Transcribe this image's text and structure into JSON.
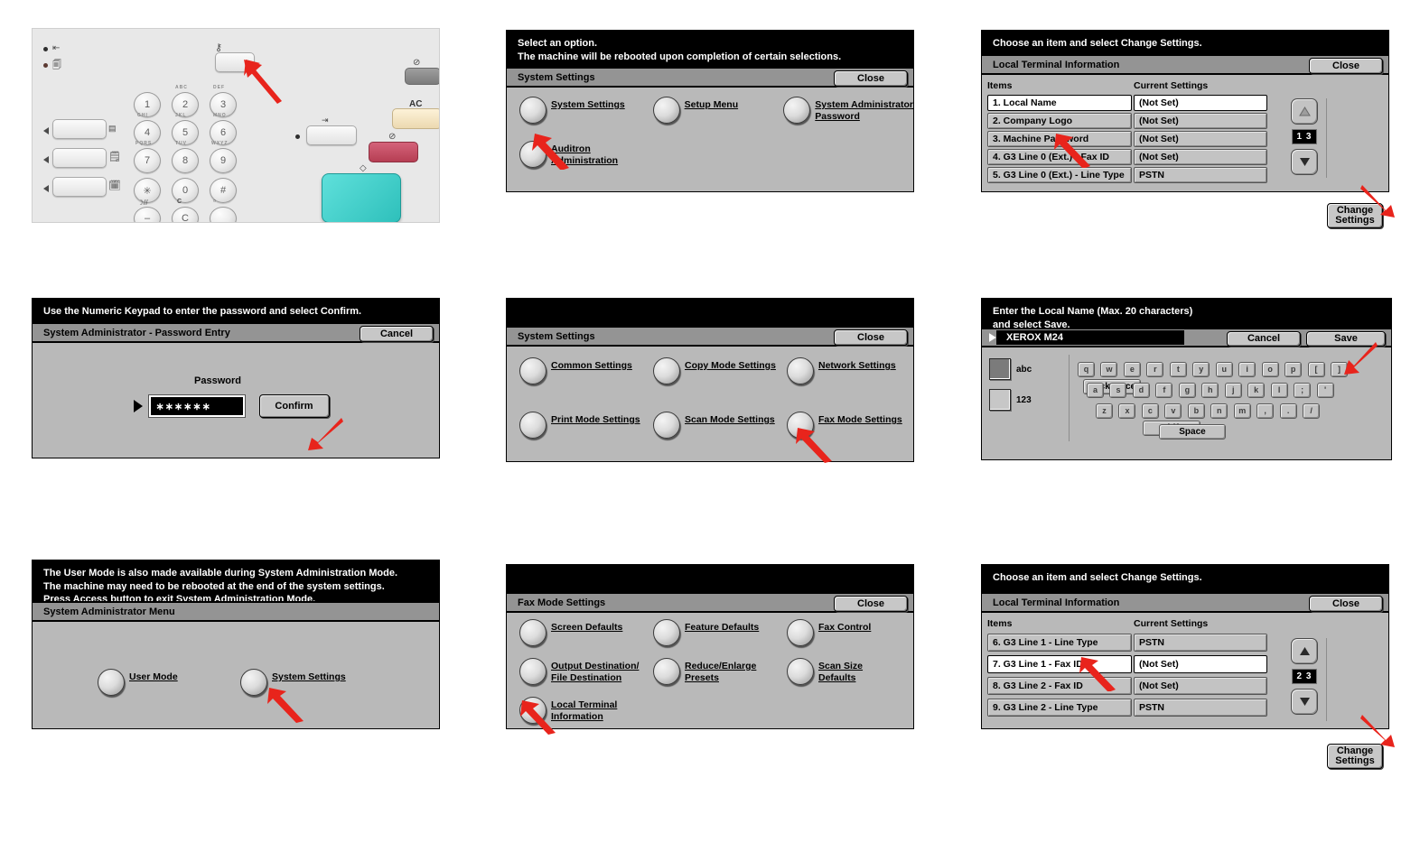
{
  "figure": {
    "panel1": {
      "name": "control-panel-photo",
      "keys": [
        "1",
        "2",
        "3",
        "4",
        "5",
        "6",
        "7",
        "8",
        "9",
        "*",
        "0",
        "#",
        "-",
        "C",
        ""
      ],
      "key_letters": [
        "ABC",
        "DEF",
        "GHI",
        "JKL",
        "MNO",
        "PQRS",
        "TUV",
        "WXYZ"
      ],
      "ac_label": "AC",
      "c_label": "C"
    },
    "panel2": {
      "message": [
        "Select an option.",
        "The machine will be rebooted upon completion of certain selections."
      ],
      "title": "System Settings",
      "close": "Close",
      "options": [
        {
          "label": [
            "System Settings"
          ]
        },
        {
          "label": [
            "Setup Menu"
          ]
        },
        {
          "label": [
            "System Administrator",
            "Password"
          ]
        },
        {
          "label": [
            "Auditron",
            "Administration"
          ]
        }
      ]
    },
    "panel3": {
      "message": [
        "Choose an item and select Change Settings."
      ],
      "title": "Local Terminal Information",
      "close": "Close",
      "col_items": "Items",
      "col_settings": "Current Settings",
      "page": "1 3",
      "change_settings": [
        "Change",
        "Settings"
      ],
      "rows": [
        {
          "item": "1. Local Name",
          "value": "(Not Set)",
          "selected": true
        },
        {
          "item": "2. Company Logo",
          "value": "(Not Set)",
          "selected": false
        },
        {
          "item": "3. Machine Password",
          "value": "(Not Set)",
          "selected": false
        },
        {
          "item": "4. G3 Line 0 (Ext.) - Fax ID",
          "value": "(Not Set)",
          "selected": false
        },
        {
          "item": "5. G3 Line 0 (Ext.) - Line Type",
          "value": "PSTN",
          "selected": false
        }
      ]
    },
    "panel4": {
      "message": [
        "Use the Numeric Keypad to enter the password and select Confirm."
      ],
      "title": "System Administrator - Password Entry",
      "cancel": "Cancel",
      "password_label": "Password",
      "password_value": "∗∗∗∗∗∗",
      "confirm": "Confirm"
    },
    "panel5": {
      "message": [
        ""
      ],
      "title": "System Settings",
      "close": "Close",
      "options": [
        {
          "label": [
            "Common Settings"
          ]
        },
        {
          "label": [
            "Copy Mode Settings"
          ]
        },
        {
          "label": [
            "Network Settings"
          ]
        },
        {
          "label": [
            "Print Mode Settings"
          ]
        },
        {
          "label": [
            "Scan Mode Settings"
          ]
        },
        {
          "label": [
            "Fax Mode Settings"
          ]
        }
      ]
    },
    "panel6": {
      "message": [
        "Enter the Local Name (Max. 20 characters)",
        "and select Save."
      ],
      "input_value": "XEROX M24",
      "cancel": "Cancel",
      "save": "Save",
      "mode_abc": "abc",
      "mode_123": "123",
      "row1": [
        "q",
        "w",
        "e",
        "r",
        "t",
        "y",
        "u",
        "i",
        "o",
        "p",
        "[",
        "]"
      ],
      "row2": [
        "a",
        "s",
        "d",
        "f",
        "g",
        "h",
        "j",
        "k",
        "l",
        ";",
        "'"
      ],
      "row3": [
        "z",
        "x",
        "c",
        "v",
        "b",
        "n",
        "m",
        ",",
        ".",
        "/"
      ],
      "backspace": "Backspace",
      "shift": "Shift",
      "space": "Space"
    },
    "panel7": {
      "message": [
        "The User Mode is also made available during System Administration Mode.",
        "The machine may need to be rebooted at the end of the system settings.",
        "Press Access button to exit System Administration Mode."
      ],
      "title": "System Administrator Menu",
      "options": [
        {
          "label": [
            "User Mode"
          ]
        },
        {
          "label": [
            "System Settings"
          ]
        }
      ]
    },
    "panel8": {
      "message": [
        ""
      ],
      "title": "Fax Mode Settings",
      "close": "Close",
      "options": [
        {
          "label": [
            "Screen Defaults"
          ]
        },
        {
          "label": [
            "Feature Defaults"
          ]
        },
        {
          "label": [
            "Fax Control"
          ]
        },
        {
          "label": [
            "Output Destination/",
            "File Destination"
          ]
        },
        {
          "label": [
            "Reduce/Enlarge",
            "Presets"
          ]
        },
        {
          "label": [
            "Scan Size",
            "Defaults"
          ]
        },
        {
          "label": [
            "Local Terminal",
            "Information"
          ]
        }
      ]
    },
    "panel9": {
      "message": [
        "Choose an item and select Change Settings."
      ],
      "title": "Local Terminal Information",
      "close": "Close",
      "col_items": "Items",
      "col_settings": "Current Settings",
      "page": "2 3",
      "change_settings": [
        "Change",
        "Settings"
      ],
      "rows": [
        {
          "item": "6. G3 Line 1 - Line Type",
          "value": "PSTN",
          "selected": false
        },
        {
          "item": "7. G3 Line 1 - Fax ID",
          "value": "(Not Set)",
          "selected": true
        },
        {
          "item": "8. G3 Line 2 - Fax ID",
          "value": "(Not Set)",
          "selected": false
        },
        {
          "item": "9. G3 Line 2 - Line Type",
          "value": "PSTN",
          "selected": false
        }
      ]
    }
  },
  "colors": {
    "arrow_red": "#e8241c",
    "screen_bg": "#b9b9b9",
    "titlebar": "#949494",
    "msgbar": "#000000",
    "start_button": "#3fd2cd",
    "stop_button": "#c4455a",
    "ac_button": "#f6e3bd"
  }
}
